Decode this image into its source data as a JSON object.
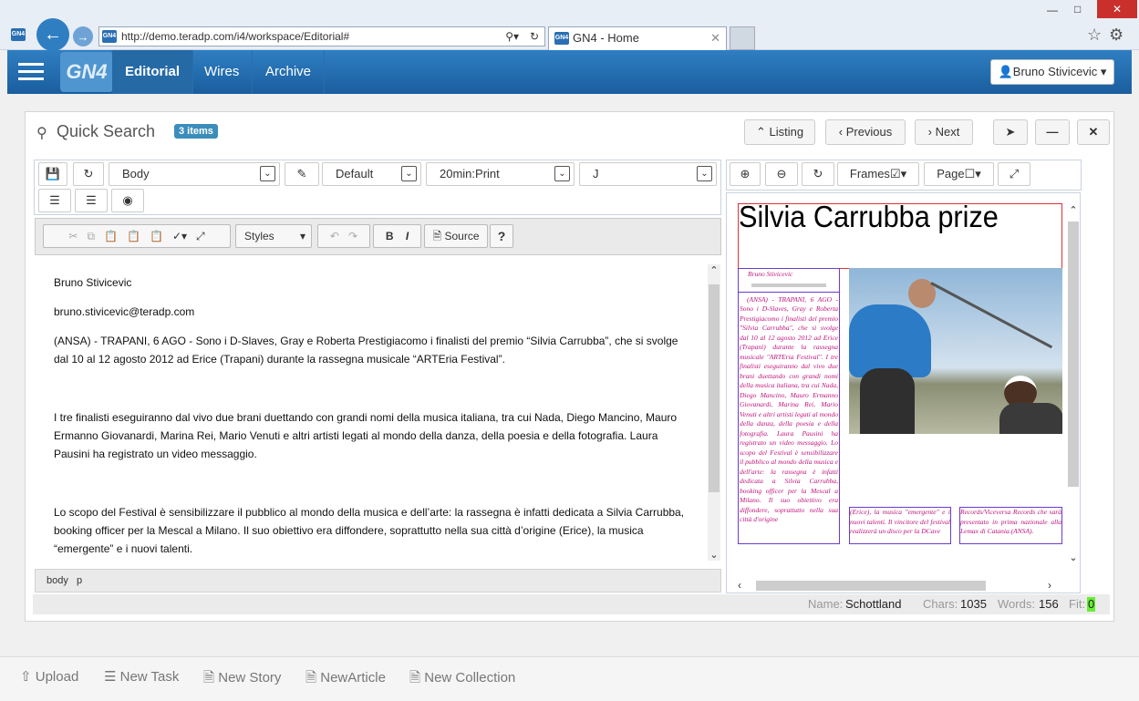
{
  "browser": {
    "url": "http://demo.teradp.com/i4/workspace/Editorial#",
    "tab_title": "GN4 - Home",
    "favicon_text": "GN4"
  },
  "nav": {
    "logo": "GN4",
    "items": [
      "Editorial",
      "Wires",
      "Archive"
    ],
    "user": "Bruno Stivicevic"
  },
  "quick_search": {
    "title": "Quick Search",
    "count": "3 items",
    "listing": "Listing",
    "previous": "Previous",
    "next": "Next"
  },
  "toolbar": {
    "style_value": "Body",
    "mode_value": "Default",
    "template_value": "20min:Print",
    "letter_value": "J",
    "frames_label": "Frames",
    "page_label": "Page",
    "styles_label": "Styles",
    "source_label": "Source"
  },
  "article": {
    "author": "Bruno Stivicevic",
    "email": "bruno.stivicevic@teradp.com",
    "p1": "(ANSA) - TRAPANI, 6 AGO - Sono i D-Slaves, Gray e Roberta Prestigiacomo i finalisti del premio “Silvia Carrubba”, che si svolge dal 10 al 12 agosto 2012 ad Erice (Trapani) durante la rassegna musicale “ARTEria Festival”.",
    "p2": "I tre finalisti eseguiranno dal vivo due brani duettando con grandi nomi della musica italiana, tra cui Nada, Diego Mancino, Mauro Ermanno Giovanardi, Marina Rei, Mario Venuti e altri artisti legati al mondo della danza, della poesia e della fotografia. Laura Pausini ha registrato un video messaggio.",
    "p3": "Lo scopo del Festival è sensibilizzare il pubblico al mondo della musica e dell’arte: la rassegna è infatti dedicata a Silvia Carrubba, booking officer per la Mescal a Milano. Il suo obiettivo era diffondere, soprattutto nella sua città d’origine (Erice), la musica “emergente” e i nuovi talenti."
  },
  "editor_path": [
    "body",
    "p"
  ],
  "preview": {
    "headline": "Silvia Carrubba prize",
    "byline": "Bruno Stivicevic",
    "col1": "(ANSA) - TRAPANI, 6 AGO - Sono i D-Slaves, Gray e Roberta Prestigiacomo i finalisti del premio \"Silvia Carrubba\", che si svolge dal 10 al 12 agosto 2012 ad Erice (Trapani) durante la rassegna musicale \"ARTEria Festival\". I tre finalisti eseguiranno dal vivo due brani duettando con grandi nomi della musica italiana, tra cui Nada, Diego Mancino, Mauro Ermanno Giovanardi, Marina Rei, Mario Venuti e altri artisti legati al mondo della danza, della poesia e della fotografia. Laura Pausini ha registrato un video messaggio. Lo scopo del Festival è sensibilizzare il pubblico al mondo della musica e dell'arte: la rassegna è infatti dedicata a Silvia Carrubba, booking officer per la Mescal a Milano. Il suo obiettivo era diffondere, soprattutto nella sua città d'origine",
    "col2": "(Erice), la musica \"emergente\" e i nuovi talenti. Il vincitore del festival realizzerà un disco per la DCave",
    "col3": "Records/Viceversa Records che sarà presentato in prima nazionale alla Lemax di Catania.(ANSA)."
  },
  "status": {
    "name_label": "Name:",
    "name": "Schottland",
    "chars_label": "Chars:",
    "chars": "1035",
    "words_label": "Words:",
    "words": "156",
    "fit_label": "Fit:",
    "fit": "0"
  },
  "footer": {
    "upload": "Upload",
    "new_task": "New Task",
    "new_story": "New Story",
    "new_article": "NewArticle",
    "new_collection": "New Collection"
  },
  "colors": {
    "nav": "#1f6aa8",
    "badge": "#3c8dbc",
    "magazine_text": "#c0127a",
    "fit_bg": "#66ee33"
  }
}
